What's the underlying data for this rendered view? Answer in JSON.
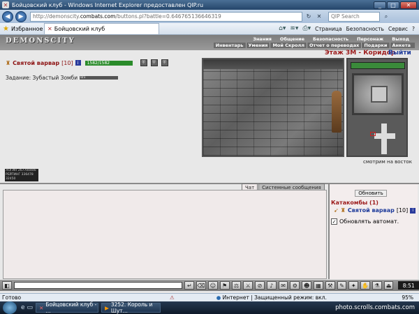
{
  "window": {
    "title": "Бойцовский клуб - Windows Internet Explorer предоставлен QIP.ru"
  },
  "addressbar": {
    "url_prefix": "http://demonscity.",
    "url_domain": "combats.com",
    "url_rest": "/buttons.pl?battle=0.646765136646319",
    "search_placeholder": "QIP Search"
  },
  "toolbar": {
    "favorites_label": "Избранное",
    "tab_title": "Бойцовский клуб",
    "page_menu": "Страница",
    "safety_menu": "Безопасность",
    "service_menu": "Сервис"
  },
  "game": {
    "logo": "DEMONSCITY",
    "menu_top": [
      "Знания",
      "Общение",
      "Безопасность",
      "Персонаж",
      "Выход"
    ],
    "menu_bottom": [
      "Инвентарь",
      "Умения",
      "Мой Скролл",
      "Отчет о переводах",
      "Подарки",
      "Анкета"
    ],
    "player": {
      "name": "Святой варвар",
      "level": "[10]",
      "hp": "1582/1582",
      "hp_fraction": 1.0
    },
    "task": {
      "label": "Задание: Зубастый Зомби",
      "progress_text": "0/1"
    },
    "counter_lines": [
      "ЛОГИН 267700446",
      "РЕЙТИНГ 336478",
      "32450"
    ],
    "location_title": "Этаж 3М - Коридор",
    "exit_label": "Выйти",
    "view_caption": "смотрим на восток"
  },
  "chat": {
    "tabs": [
      "Чат",
      "Системные сообщения"
    ],
    "refresh_button": "Обновить",
    "room_title": "Катакомбы (1)",
    "room_user": {
      "name": "Святой варвар",
      "level": "[10]"
    },
    "auto_refresh_label": "Обновлять автомат.",
    "clock": "8:51"
  },
  "statusbar": {
    "ready": "Готово",
    "zone": "Интернет | Защищенный режим: вкл.",
    "zoom": "95%"
  },
  "taskbar": {
    "btn1": "Бойцовский клуб - ...",
    "btn2": "3252. Король и Шут...",
    "watermark": "photo.scrolls.combats.com"
  }
}
